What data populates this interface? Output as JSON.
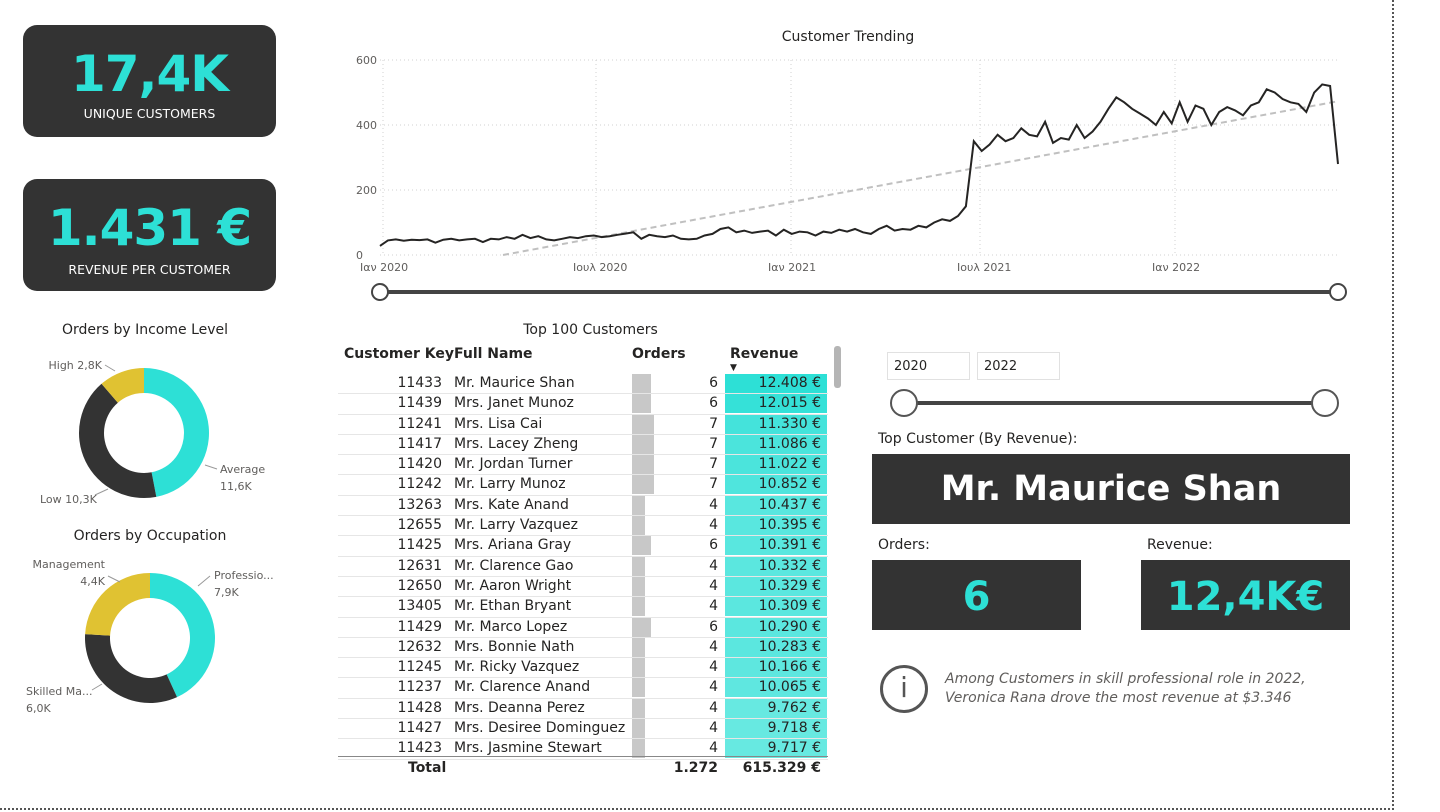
{
  "kpis": {
    "unique_customers_value": "17,4K",
    "unique_customers_label": "UNIQUE CUSTOMERS",
    "revenue_per_customer_value": "1.431 €",
    "revenue_per_customer_label": "REVENUE PER CUSTOMER"
  },
  "colors": {
    "accent": "#2de0d6",
    "dark": "#333333",
    "gold": "#e0c232",
    "track": "#444444"
  },
  "chart_data": [
    {
      "type": "line",
      "title": "Customer Trending",
      "x_tick_labels": [
        "Ιαν 2020",
        "Ιουλ 2020",
        "Ιαν 2021",
        "Ιουλ 2021",
        "Ιαν 2022"
      ],
      "y_tick_labels": [
        "0",
        "200",
        "400",
        "600"
      ],
      "ylim": [
        0,
        600
      ],
      "x_range": [
        "2020-01",
        "2022-06"
      ],
      "grid": true,
      "trendline": true,
      "series": [
        {
          "values": [
            28,
            45,
            48,
            44,
            47,
            46,
            48,
            38,
            47,
            50,
            45,
            48,
            50,
            40,
            50,
            48,
            55,
            50,
            62,
            52,
            58,
            48,
            45,
            50,
            55,
            52,
            58,
            60,
            55,
            58,
            62,
            66,
            70,
            50,
            62,
            58,
            55,
            60,
            50,
            48,
            50,
            60,
            65,
            80,
            85,
            70,
            75,
            68,
            72,
            75,
            60,
            78,
            65,
            72,
            70,
            60,
            72,
            68,
            78,
            72,
            80,
            70,
            65,
            80,
            90,
            75,
            80,
            78,
            90,
            85,
            100,
            110,
            105,
            120,
            150,
            350,
            320,
            340,
            370,
            350,
            360,
            390,
            370,
            365,
            410,
            345,
            360,
            355,
            400,
            360,
            380,
            410,
            450,
            485,
            470,
            450,
            435,
            420,
            400,
            440,
            405,
            470,
            410,
            460,
            450,
            400,
            440,
            455,
            445,
            430,
            460,
            470,
            510,
            500,
            480,
            470,
            465,
            440,
            500,
            525,
            520,
            280
          ]
        }
      ]
    },
    {
      "type": "pie",
      "title": "Orders by Income Level",
      "slices": [
        {
          "label": "Average",
          "value": 11.6,
          "value_label": "11,6K",
          "color": "#2de0d6"
        },
        {
          "label": "Low",
          "value": 10.3,
          "value_label": "10,3K",
          "color": "#333333"
        },
        {
          "label": "High",
          "value": 2.8,
          "value_label": "2,8K",
          "color": "#e0c232"
        }
      ]
    },
    {
      "type": "pie",
      "title": "Orders by Occupation",
      "slices": [
        {
          "label": "Professio...",
          "value": 7.9,
          "value_label": "7,9K",
          "color": "#2de0d6"
        },
        {
          "label": "Skilled Ma...",
          "value": 6.0,
          "value_label": "6,0K",
          "color": "#333333"
        },
        {
          "label": "Management",
          "value": 4.4,
          "value_label": "4,4K",
          "color": "#e0c232"
        }
      ]
    }
  ],
  "table": {
    "title": "Top 100 Customers",
    "headers": {
      "key": "Customer Key",
      "name": "Full Name",
      "orders": "Orders",
      "revenue": "Revenue"
    },
    "rows": [
      {
        "key": "11433",
        "name": "Mr. Maurice Shan",
        "orders": "6",
        "revenue": "12.408 €",
        "rev": 12408
      },
      {
        "key": "11439",
        "name": "Mrs. Janet Munoz",
        "orders": "6",
        "revenue": "12.015 €",
        "rev": 12015
      },
      {
        "key": "11241",
        "name": "Mrs. Lisa Cai",
        "orders": "7",
        "revenue": "11.330 €",
        "rev": 11330
      },
      {
        "key": "11417",
        "name": "Mrs. Lacey Zheng",
        "orders": "7",
        "revenue": "11.086 €",
        "rev": 11086
      },
      {
        "key": "11420",
        "name": "Mr. Jordan Turner",
        "orders": "7",
        "revenue": "11.022 €",
        "rev": 11022
      },
      {
        "key": "11242",
        "name": "Mr. Larry Munoz",
        "orders": "7",
        "revenue": "10.852 €",
        "rev": 10852
      },
      {
        "key": "13263",
        "name": "Mrs. Kate Anand",
        "orders": "4",
        "revenue": "10.437 €",
        "rev": 10437
      },
      {
        "key": "12655",
        "name": "Mr. Larry Vazquez",
        "orders": "4",
        "revenue": "10.395 €",
        "rev": 10395
      },
      {
        "key": "11425",
        "name": "Mrs. Ariana Gray",
        "orders": "6",
        "revenue": "10.391 €",
        "rev": 10391
      },
      {
        "key": "12631",
        "name": "Mr. Clarence Gao",
        "orders": "4",
        "revenue": "10.332 €",
        "rev": 10332
      },
      {
        "key": "12650",
        "name": "Mr. Aaron Wright",
        "orders": "4",
        "revenue": "10.329 €",
        "rev": 10329
      },
      {
        "key": "13405",
        "name": "Mr. Ethan Bryant",
        "orders": "4",
        "revenue": "10.309 €",
        "rev": 10309
      },
      {
        "key": "11429",
        "name": "Mr. Marco Lopez",
        "orders": "6",
        "revenue": "10.290 €",
        "rev": 10290
      },
      {
        "key": "12632",
        "name": "Mrs. Bonnie Nath",
        "orders": "4",
        "revenue": "10.283 €",
        "rev": 10283
      },
      {
        "key": "11245",
        "name": "Mr. Ricky Vazquez",
        "orders": "4",
        "revenue": "10.166 €",
        "rev": 10166
      },
      {
        "key": "11237",
        "name": "Mr. Clarence Anand",
        "orders": "4",
        "revenue": "10.065 €",
        "rev": 10065
      },
      {
        "key": "11428",
        "name": "Mrs. Deanna Perez",
        "orders": "4",
        "revenue": "9.762 €",
        "rev": 9762
      },
      {
        "key": "11427",
        "name": "Mrs. Desiree Dominguez",
        "orders": "4",
        "revenue": "9.718 €",
        "rev": 9718
      },
      {
        "key": "11423",
        "name": "Mrs. Jasmine Stewart",
        "orders": "4",
        "revenue": "9.717 €",
        "rev": 9717
      }
    ],
    "total_label": "Total",
    "total_orders": "1.272",
    "total_revenue": "615.329 €"
  },
  "slicer": {
    "start": "2020",
    "end": "2022"
  },
  "top_customer": {
    "heading": "Top Customer (By Revenue):",
    "name": "Mr. Maurice Shan",
    "orders_label": "Orders:",
    "orders_value": "6",
    "revenue_label": "Revenue:",
    "revenue_value": "12,4K€"
  },
  "insight": {
    "icon": "info-icon",
    "icon_glyph": "i",
    "text": "Among Customers in skill professional role in 2022, Veronica Rana drove the most revenue at $3.346"
  }
}
